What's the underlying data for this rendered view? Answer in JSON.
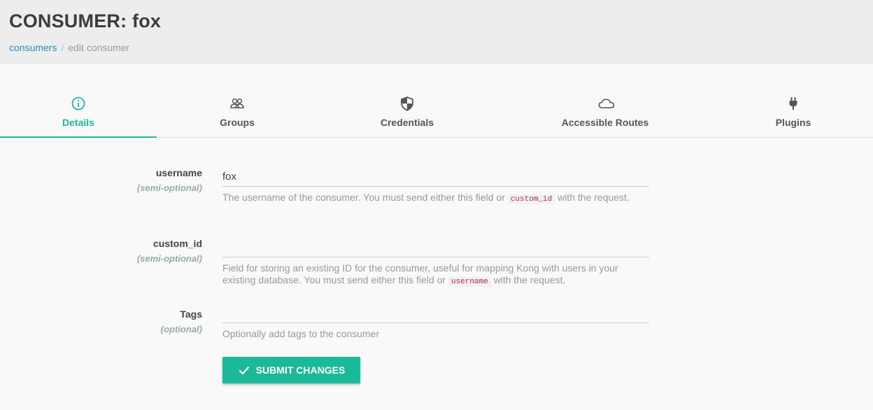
{
  "header": {
    "title": "CONSUMER: fox",
    "breadcrumb": {
      "link": "consumers",
      "separator": "/",
      "current": "edit consumer"
    }
  },
  "tabs": [
    {
      "label": "Details",
      "icon": "info-circle-icon",
      "active": true
    },
    {
      "label": "Groups",
      "icon": "users-icon",
      "active": false
    },
    {
      "label": "Credentials",
      "icon": "shield-icon",
      "active": false
    },
    {
      "label": "Accessible Routes",
      "icon": "cloud-icon",
      "active": false
    },
    {
      "label": "Plugins",
      "icon": "plug-icon",
      "active": false
    }
  ],
  "form": {
    "username": {
      "label": "username",
      "qualifier": "(semi-optional)",
      "value": "fox",
      "help_before": "The username of the consumer. You must send either this field or",
      "help_code": "custom_id",
      "help_after": "with the request."
    },
    "custom_id": {
      "label": "custom_id",
      "qualifier": "(semi-optional)",
      "value": "",
      "help_before": "Field for storing an existing ID for the consumer, useful for mapping Kong with users in your existing database. You must send either this field or",
      "help_code": "username",
      "help_after": "with the request."
    },
    "tags": {
      "label": "Tags",
      "qualifier": "(optional)",
      "value": "",
      "help": "Optionally add tags to the consumer"
    },
    "submit_label": "SUBMIT CHANGES"
  },
  "colors": {
    "accent": "#1bb99a",
    "link": "#2f8bc7",
    "code": "#c7254e"
  }
}
